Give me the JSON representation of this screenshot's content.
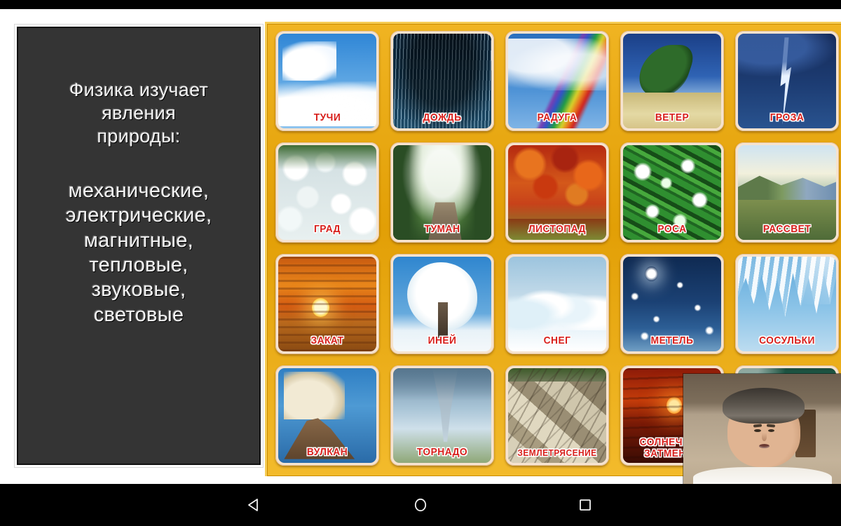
{
  "slide": {
    "text_panel": {
      "intro_lines": [
        "Физика  изучает",
        "явления",
        "природы:"
      ],
      "kind_lines": [
        "механические,",
        "электрические,",
        "магнитные,",
        "тепловые,",
        "звуковые,",
        "световые"
      ]
    },
    "grid": {
      "background_color": "#e9a60f",
      "label_color": "#d8201c",
      "columns": 5,
      "rows": 4,
      "tiles": [
        {
          "label": "ТУЧИ",
          "art": "clouds",
          "row": 1,
          "col": 1
        },
        {
          "label": "ДОЖДЬ",
          "art": "rain",
          "row": 1,
          "col": 2
        },
        {
          "label": "РАДУГА",
          "art": "rainbow",
          "row": 1,
          "col": 3
        },
        {
          "label": "ВЕТЕР",
          "art": "wind",
          "row": 1,
          "col": 4
        },
        {
          "label": "ГРОЗА",
          "art": "storm",
          "row": 1,
          "col": 5
        },
        {
          "label": "ГРАД",
          "art": "hail",
          "row": 2,
          "col": 1
        },
        {
          "label": "ТУМАН",
          "art": "fog",
          "row": 2,
          "col": 2
        },
        {
          "label": "ЛИСТОПАД",
          "art": "autumn",
          "row": 2,
          "col": 3
        },
        {
          "label": "РОСА",
          "art": "dew",
          "row": 2,
          "col": 4
        },
        {
          "label": "РАССВЕТ",
          "art": "dawn",
          "row": 2,
          "col": 5
        },
        {
          "label": "ЗАКАТ",
          "art": "sunset",
          "row": 3,
          "col": 1
        },
        {
          "label": "ИНЕЙ",
          "art": "frost",
          "row": 3,
          "col": 2
        },
        {
          "label": "СНЕГ",
          "art": "snow",
          "row": 3,
          "col": 3
        },
        {
          "label": "МЕТЕЛЬ",
          "art": "blizzard",
          "row": 3,
          "col": 4
        },
        {
          "label": "СОСУЛЬКИ",
          "art": "icicles",
          "row": 3,
          "col": 5
        },
        {
          "label": "ВУЛКАН",
          "art": "volcano",
          "row": 4,
          "col": 1
        },
        {
          "label": "ТОРНАДО",
          "art": "tornado",
          "row": 4,
          "col": 2
        },
        {
          "label": "ЗЕМЛЕТРЯСЕНИЕ",
          "art": "quake",
          "row": 4,
          "col": 3
        },
        {
          "label": "СОЛНЕЧНОЕ\nЗАТМЕНИЕ",
          "art": "eclipse",
          "row": 4,
          "col": 4
        },
        {
          "label": "",
          "art": "aurora",
          "row": 4,
          "col": 5
        }
      ]
    }
  },
  "webcam": {
    "present": true,
    "position": "bottom-right"
  },
  "nav_bar": {
    "back_icon": "triangle-back-icon",
    "home_icon": "circle-home-icon",
    "recents_icon": "square-recents-icon"
  }
}
